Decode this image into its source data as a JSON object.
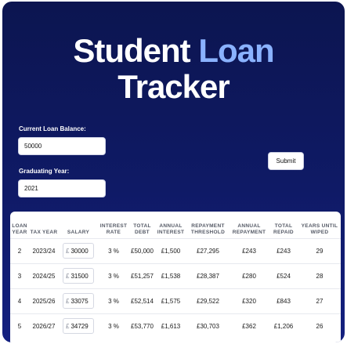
{
  "title": {
    "part1": "Student",
    "part2": "Loan",
    "part3": "Tracker"
  },
  "form": {
    "balance_label": "Current Loan Balance:",
    "balance_value": "50000",
    "grad_label": "Graduating Year:",
    "grad_value": "2021",
    "submit_label": "Submit"
  },
  "table": {
    "headers": [
      "LOAN YEAR",
      "TAX YEAR",
      "SALARY",
      "INTEREST RATE",
      "TOTAL DEBT",
      "ANNUAL INTEREST",
      "REPAYMENT THRESHOLD",
      "ANNUAL REPAYMENT",
      "TOTAL REPAID",
      "YEARS UNTIL WIPED"
    ],
    "currency_symbol": "£",
    "rows": [
      {
        "loan_year": "2",
        "tax_year": "2023/24",
        "salary": "30000",
        "rate": "3 %",
        "total_debt": "£50,000",
        "annual_interest": "£1,500",
        "threshold": "£27,295",
        "repayment": "£243",
        "total_repaid": "£243",
        "years": "29"
      },
      {
        "loan_year": "3",
        "tax_year": "2024/25",
        "salary": "31500",
        "rate": "3 %",
        "total_debt": "£51,257",
        "annual_interest": "£1,538",
        "threshold": "£28,387",
        "repayment": "£280",
        "total_repaid": "£524",
        "years": "28"
      },
      {
        "loan_year": "4",
        "tax_year": "2025/26",
        "salary": "33075",
        "rate": "3 %",
        "total_debt": "£52,514",
        "annual_interest": "£1,575",
        "threshold": "£29,522",
        "repayment": "£320",
        "total_repaid": "£843",
        "years": "27"
      },
      {
        "loan_year": "5",
        "tax_year": "2026/27",
        "salary": "34729",
        "rate": "3 %",
        "total_debt": "£53,770",
        "annual_interest": "£1,613",
        "threshold": "£30,703",
        "repayment": "£362",
        "total_repaid": "£1,206",
        "years": "26"
      }
    ]
  }
}
